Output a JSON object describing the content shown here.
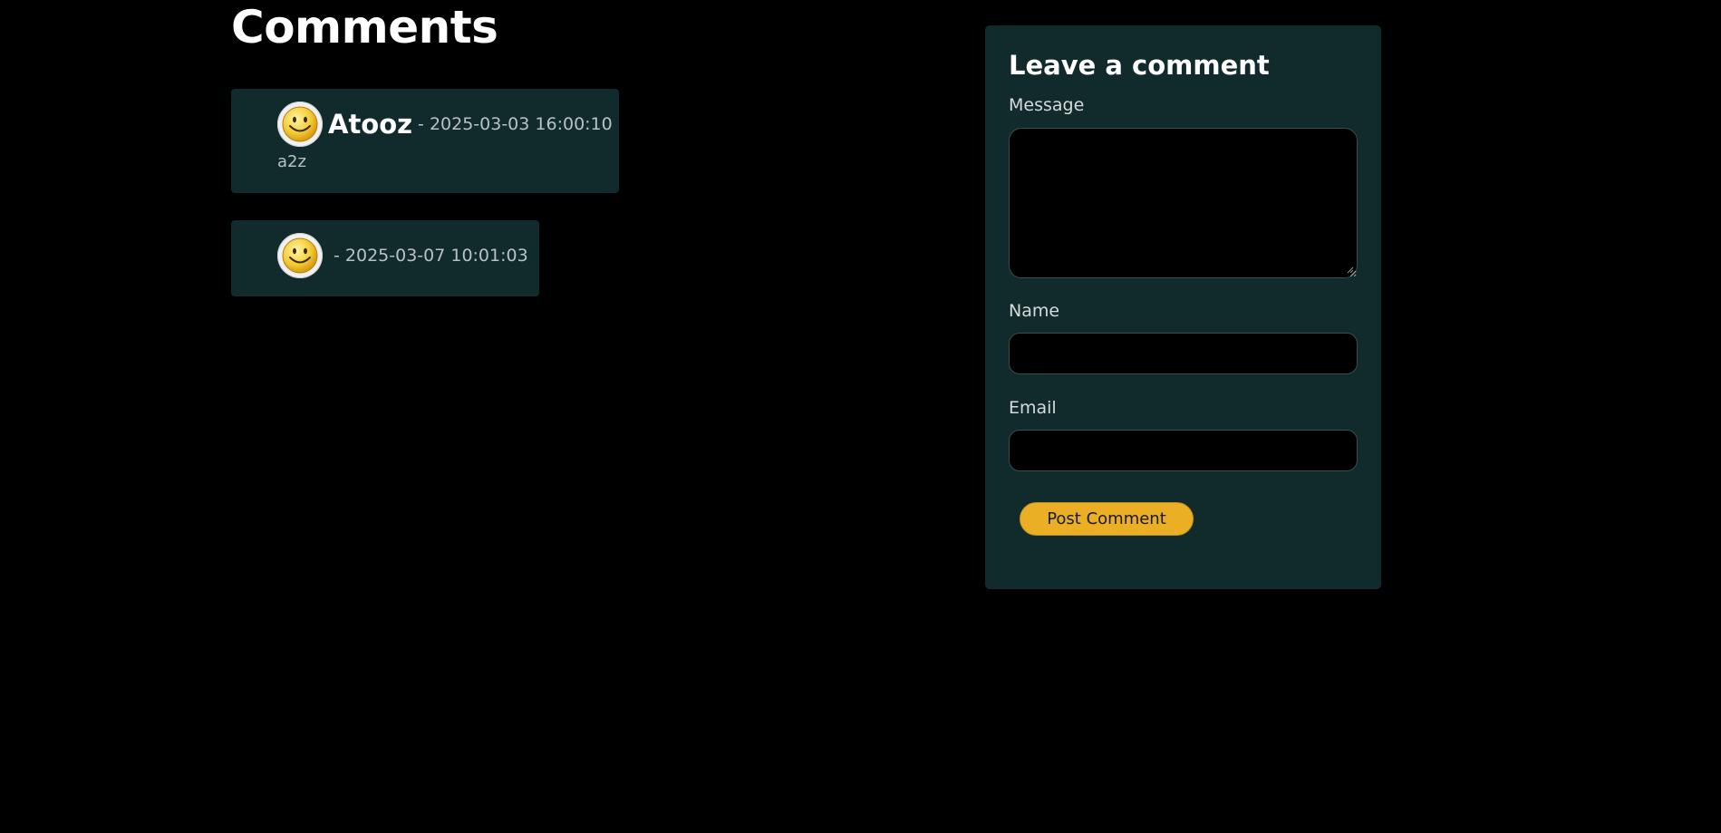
{
  "comments": {
    "title": "Comments",
    "items": [
      {
        "author": "Atooz",
        "date": "- 2025-03-03 16:00:10",
        "text": "a2z",
        "avatar_icon": "smiley-face-icon"
      },
      {
        "author": "",
        "date": "- 2025-03-07 10:01:03",
        "text": "",
        "avatar_icon": "smiley-face-icon"
      }
    ]
  },
  "form": {
    "title": "Leave a comment",
    "message_label": "Message",
    "message_value": "",
    "name_label": "Name",
    "name_value": "",
    "email_label": "Email",
    "email_value": "",
    "submit_label": "Post Comment"
  },
  "colors": {
    "background": "#000000",
    "panel": "#112b2d",
    "accent_button": "#eaaf24",
    "text_muted": "#b9c2c2"
  }
}
